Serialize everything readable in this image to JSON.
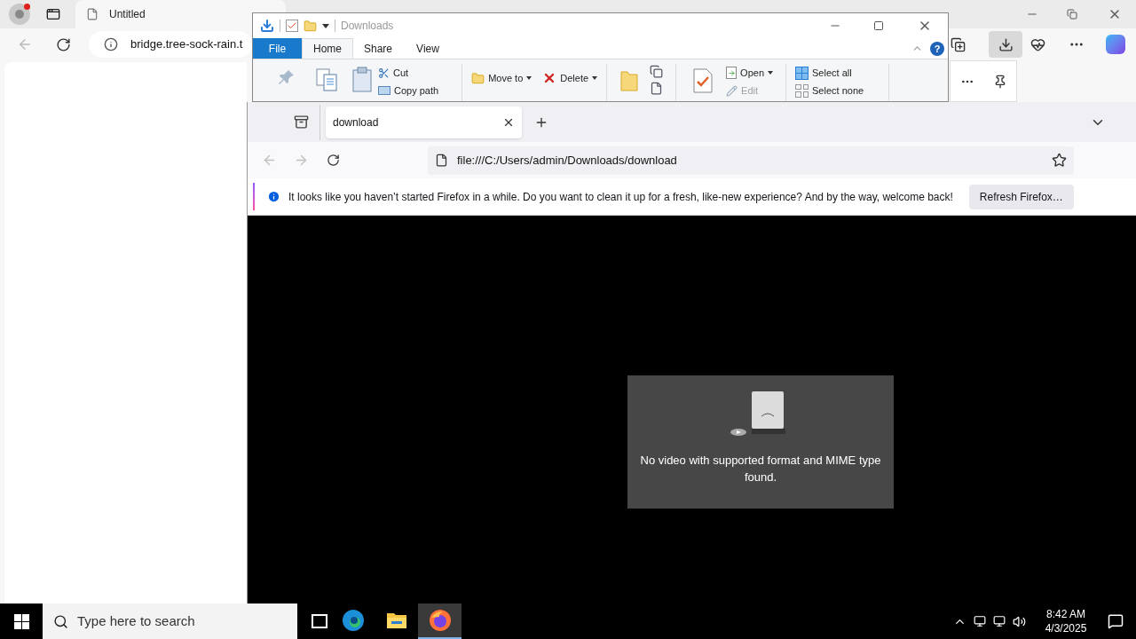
{
  "edge": {
    "tab": {
      "title": "Untitled"
    },
    "address": "bridge.tree-sock-rain.t"
  },
  "explorer": {
    "title": "Downloads",
    "help": "?",
    "ribbon_tabs": [
      {
        "label": "File",
        "kind": "file",
        "selected": false
      },
      {
        "label": "Home",
        "kind": "tab",
        "selected": true
      },
      {
        "label": "Share",
        "kind": "tab",
        "selected": false
      },
      {
        "label": "View",
        "kind": "tab",
        "selected": false
      }
    ],
    "commands": [
      {
        "label": "Cut",
        "kind": "cut",
        "disabled": false
      },
      {
        "label": "Copy path",
        "kind": "copy-path",
        "disabled": false
      },
      {
        "label": "Move to",
        "kind": "move",
        "disabled": false
      },
      {
        "label": "Delete",
        "kind": "delete",
        "disabled": false
      },
      {
        "label": "Open",
        "kind": "open",
        "disabled": false
      },
      {
        "label": "Edit",
        "kind": "edit",
        "disabled": true
      },
      {
        "label": "Select all",
        "kind": "select-all",
        "disabled": false
      },
      {
        "label": "Select none",
        "kind": "select-none",
        "disabled": false
      }
    ]
  },
  "firefox": {
    "tab": {
      "title": "download"
    },
    "url": "file:///C:/Users/admin/Downloads/download",
    "notification": {
      "message": "It looks like you haven’t started Firefox in a while. Do you want to clean it up for a fresh, like-new experience? And by the way, welcome back!",
      "button": "Refresh Firefox…"
    },
    "video_error": "No video with supported format and MIME type found."
  },
  "taskbar": {
    "search_placeholder": "Type here to search",
    "time": "8:42 AM",
    "date": "4/3/2025",
    "apps": [
      {
        "kind": "edge",
        "selected": false
      },
      {
        "kind": "explorer",
        "selected": false
      },
      {
        "kind": "firefox",
        "selected": true
      }
    ]
  }
}
